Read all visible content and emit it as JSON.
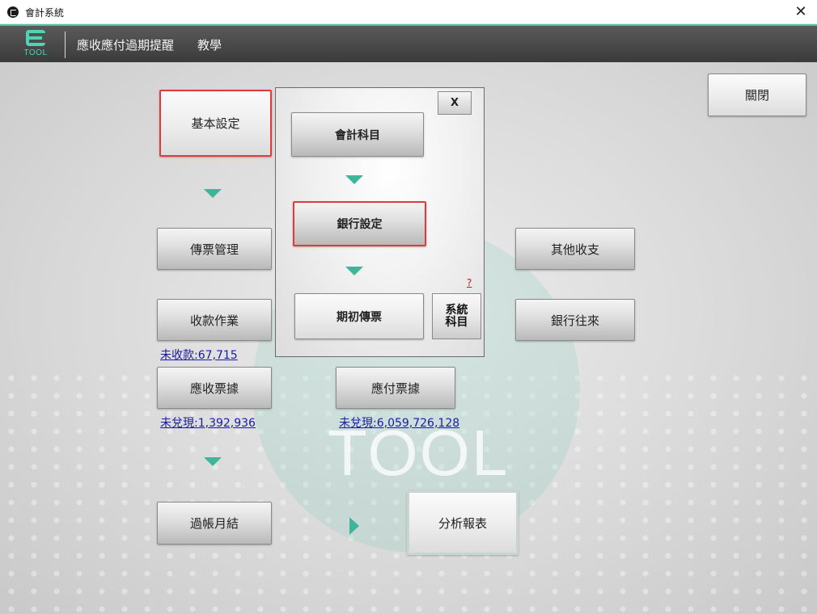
{
  "window": {
    "title": "會計系統",
    "close_glyph": "✕"
  },
  "header": {
    "logo_text": "TOOL",
    "menu": [
      "應收應付過期提醒",
      "教學"
    ]
  },
  "buttons": {
    "basic_settings": "基本設定",
    "voucher_management": "傳票管理",
    "receipt_operations": "收款作業",
    "notes_receivable": "應收票據",
    "month_end_closing": "過帳月結",
    "notes_payable": "應付票據",
    "analysis_reports": "分析報表",
    "other_income_expense": "其他收支",
    "bank_transactions": "銀行往來",
    "close": "關閉"
  },
  "links": {
    "uncollected": "未收款:67,715",
    "receivable_unredeemed": "未兌現:1,392,936",
    "payable_unredeemed": "未兌現:6,059,726,128"
  },
  "popup": {
    "close_label": "X",
    "chart_of_accounts": "會計科目",
    "bank_settings": "銀行設定",
    "opening_voucher": "期初傳票",
    "help": "?",
    "system_accounts_line1": "系統",
    "system_accounts_line2": "科目"
  },
  "colors": {
    "accent": "#4fd3b3",
    "arrow": "#3fb59a",
    "highlight": "#e23a3a",
    "link": "#1a1aa6"
  }
}
